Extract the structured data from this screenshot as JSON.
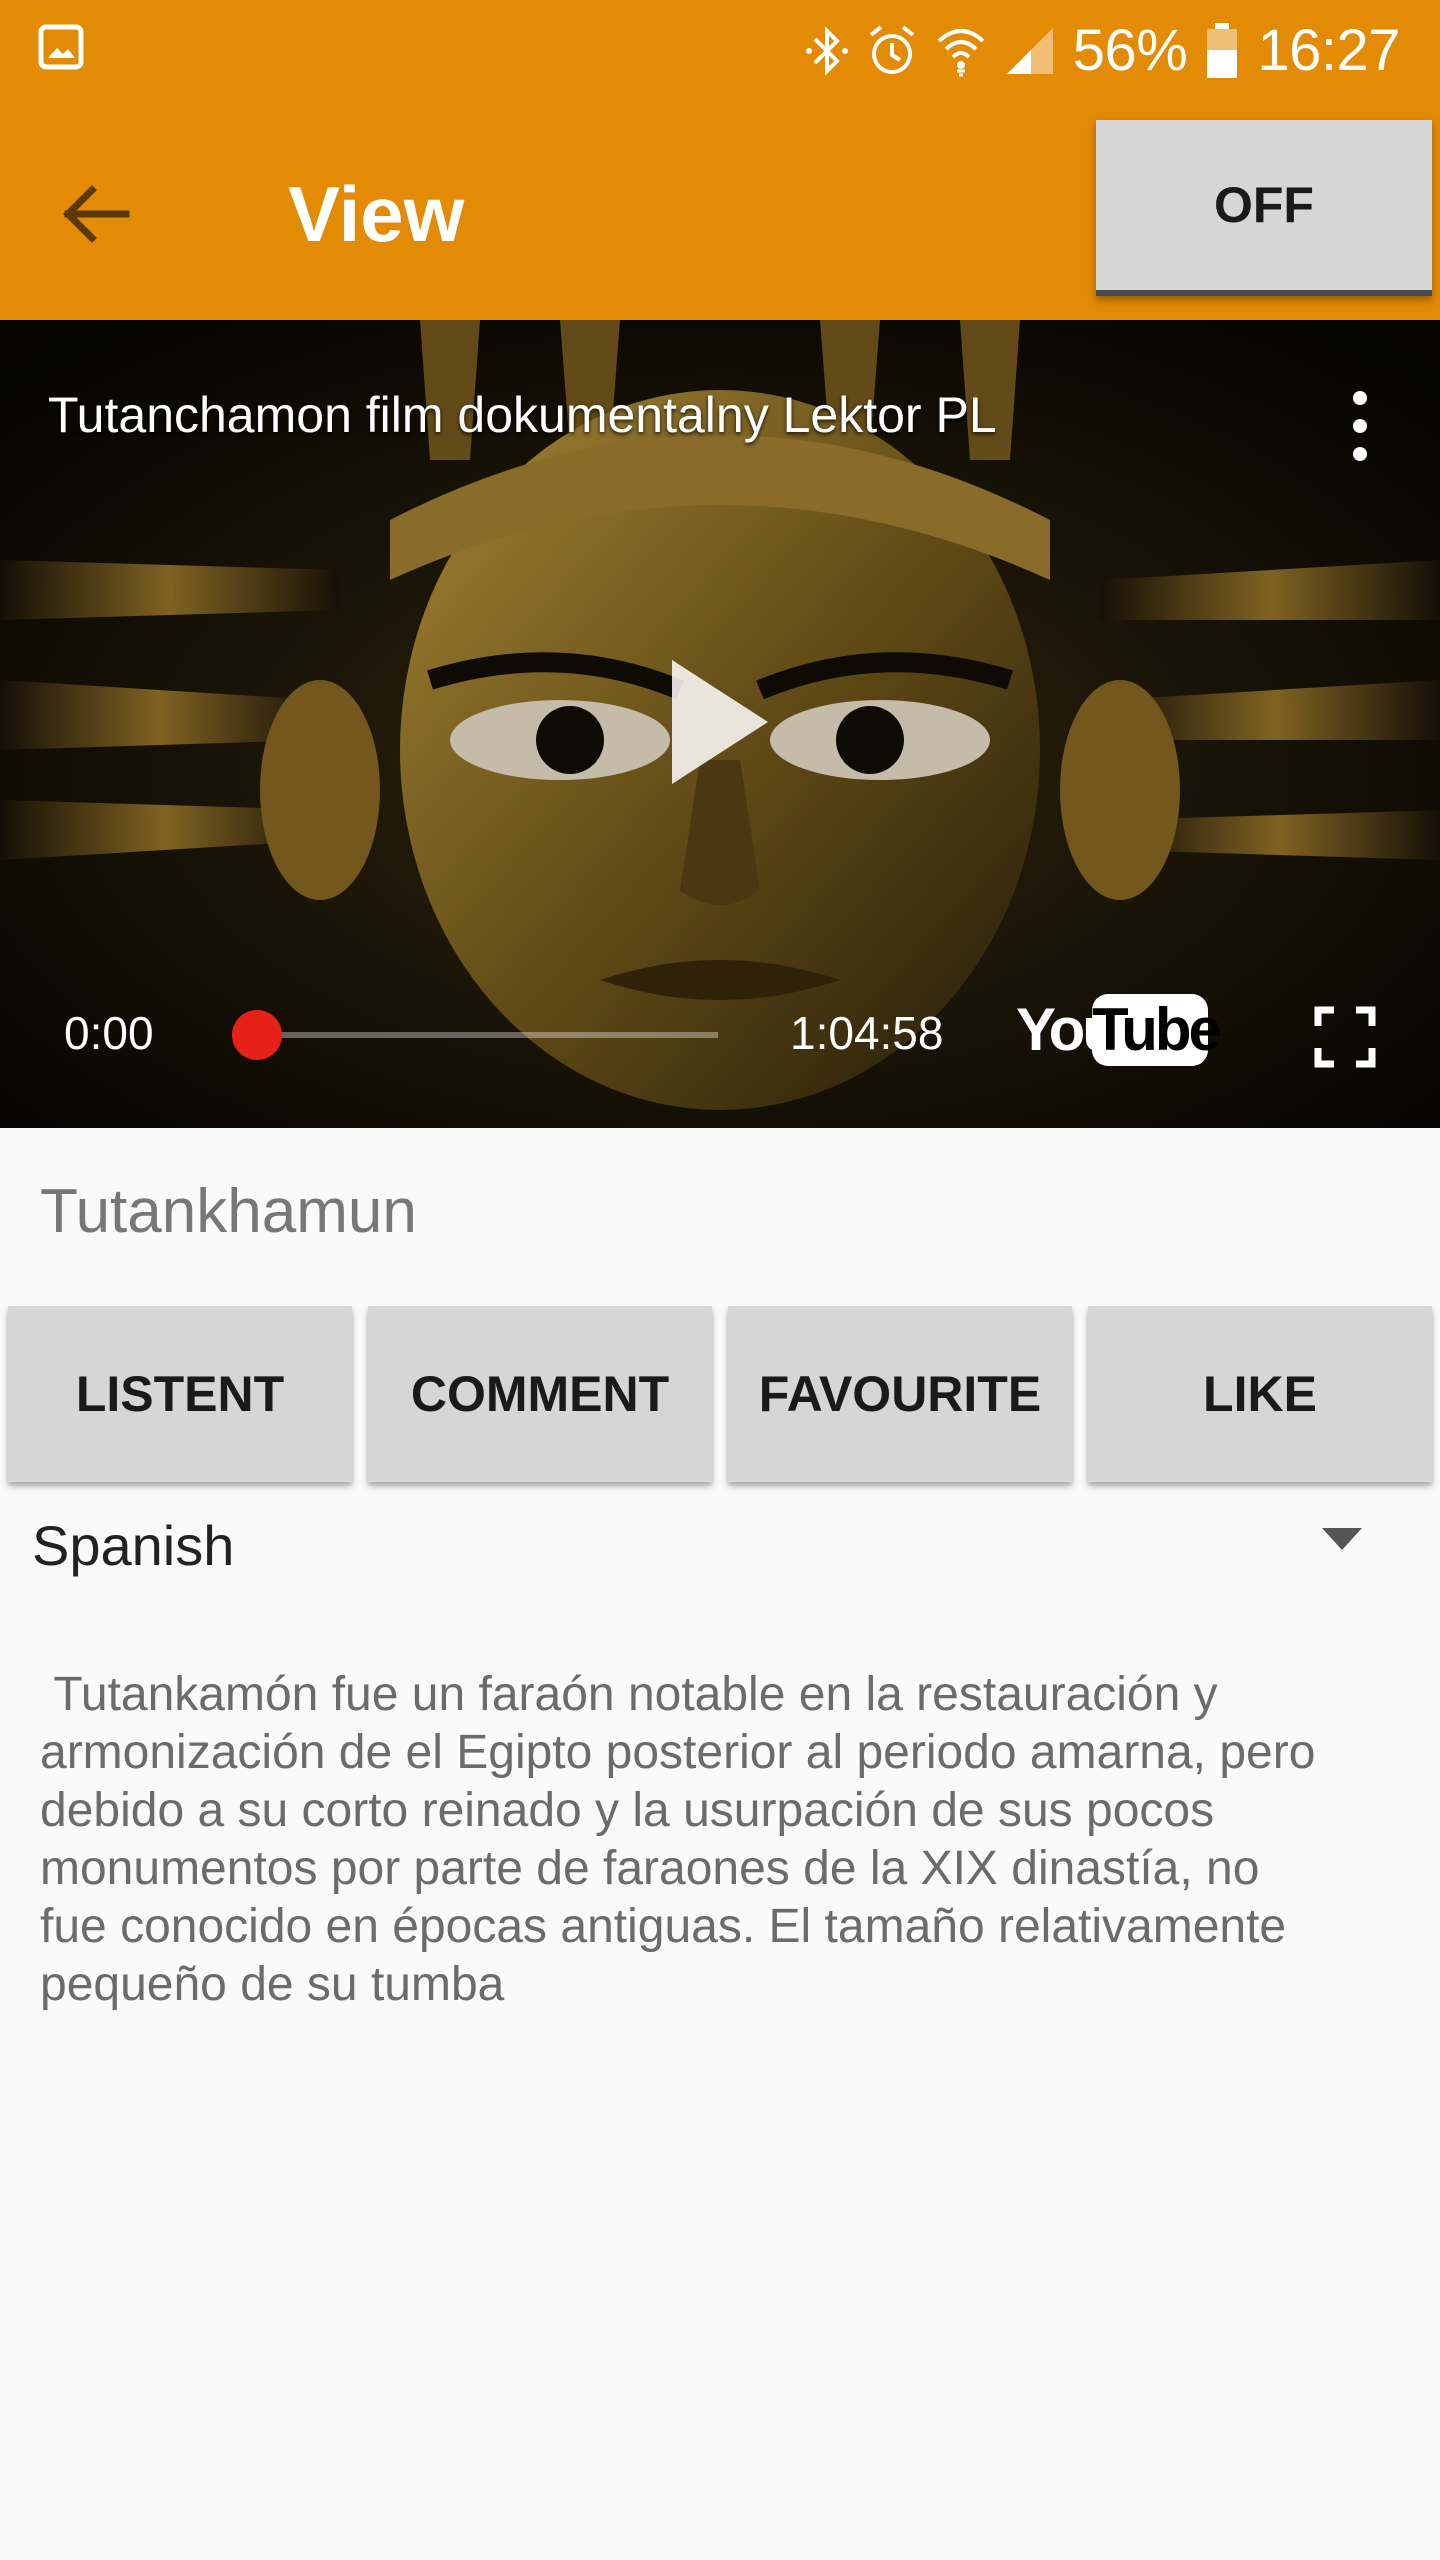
{
  "status_bar": {
    "battery": "56%",
    "time": "16:27",
    "icons": [
      "gallery-icon",
      "bluetooth-icon",
      "alarm-icon",
      "wifi-icon",
      "signal-icon",
      "battery-icon"
    ]
  },
  "app_bar": {
    "title": "View",
    "toggle_label": "OFF",
    "color": "#E38B05",
    "icons": [
      "back-arrow-icon"
    ]
  },
  "video": {
    "title": "Tutanchamon film dokumentalny Lektor PL",
    "current_time": "0:00",
    "duration": "1:04:58",
    "progress": 0,
    "brand_you": "You",
    "brand_tube": "Tube",
    "icons": [
      "more-vert-icon",
      "play-icon",
      "fullscreen-icon"
    ]
  },
  "content": {
    "name": "Tutankhamun",
    "buttons": [
      "LISTENT",
      "COMMENT",
      "FAVOURITE",
      "LIKE"
    ],
    "language": "Spanish",
    "description": " Tutankamón fue un faraón notable en la restauración y\narmonización de el Egipto posterior al periodo amarna, pero\ndebido a su corto reinado y la usurpación de sus pocos\nmonumentos por parte de faraones de la XIX dinastía, no\nfue conocido en épocas antiguas. El tamaño relativamente\npequeño de su tumba"
  }
}
